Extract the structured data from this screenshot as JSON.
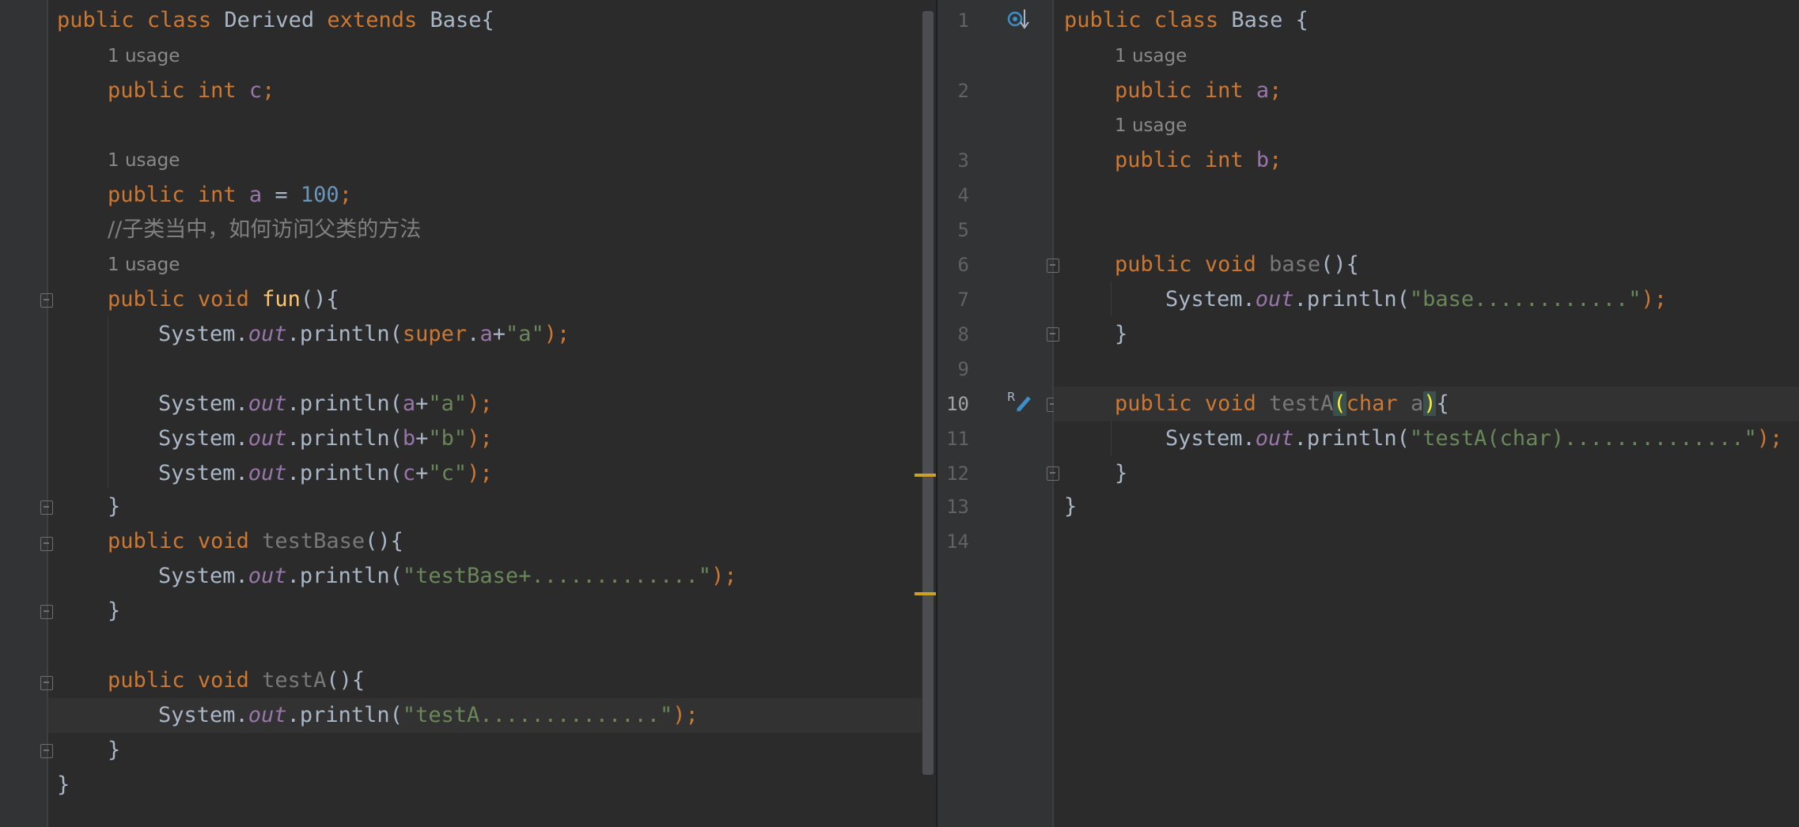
{
  "left_editor": {
    "class_decl": {
      "mod": "public",
      "cls": "class",
      "name": "Derived",
      "ext": "extends",
      "base": "Base",
      "brace": "{"
    },
    "usage_c": "1 usage",
    "field_c": {
      "mod": "public",
      "type": "int",
      "name": "c",
      "semi": ";"
    },
    "usage_a": "1 usage",
    "field_a": {
      "mod": "public",
      "type": "int",
      "name": "a",
      "eq": " = ",
      "value": "100",
      "semi": ";"
    },
    "comment": "//子类当中，如何访问父类的方法",
    "usage_fun": "1 usage",
    "fun_decl": {
      "mod": "public",
      "type": "void",
      "name": "fun",
      "tail": "(){"
    },
    "fun_line1": {
      "sys": "System.",
      "out": "out",
      "call": ".println(",
      "sup": "super",
      "dot": ".",
      "fld": "a",
      "plus": "+",
      "str": "\"a\"",
      "end": ");"
    },
    "fun_line2": {
      "sys": "System.",
      "out": "out",
      "call": ".println(",
      "fld": "a",
      "plus": "+",
      "str": "\"a\"",
      "end": ");"
    },
    "fun_line3": {
      "sys": "System.",
      "out": "out",
      "call": ".println(",
      "fld": "b",
      "plus": "+",
      "str": "\"b\"",
      "end": ");"
    },
    "fun_line4": {
      "sys": "System.",
      "out": "out",
      "call": ".println(",
      "fld": "c",
      "plus": "+",
      "str": "\"c\"",
      "end": ");"
    },
    "close1": "}",
    "testBase_decl": {
      "mod": "public",
      "type": "void",
      "name": "testBase",
      "tail": "(){"
    },
    "testBase_line": {
      "sys": "System.",
      "out": "out",
      "call": ".println(",
      "str": "\"testBase+.............\"",
      "end": ");"
    },
    "close2": "}",
    "testA_decl": {
      "mod": "public",
      "type": "void",
      "name": "testA",
      "tail": "(){"
    },
    "testA_line": {
      "sys": "System.",
      "out": "out",
      "call": ".println(",
      "str": "\"testA..............\"",
      "end": ");"
    },
    "close3": "}",
    "close_class": "}"
  },
  "right_editor": {
    "line_numbers": [
      "1",
      "2",
      "3",
      "4",
      "5",
      "6",
      "7",
      "8",
      "9",
      "10",
      "11",
      "12",
      "13",
      "14"
    ],
    "current_line": "10",
    "class_decl": {
      "mod": "public",
      "cls": "class",
      "name": "Base",
      "brace": " {"
    },
    "usage_a": "1 usage",
    "field_a": {
      "mod": "public",
      "type": "int",
      "name": "a",
      "semi": ";"
    },
    "usage_b": "1 usage",
    "field_b": {
      "mod": "public",
      "type": "int",
      "name": "b",
      "semi": ";"
    },
    "base_decl": {
      "mod": "public",
      "type": "void",
      "name": "base",
      "tail": "(){"
    },
    "base_line": {
      "sys": "System.",
      "out": "out",
      "call": ".println(",
      "str": "\"base............\"",
      "end": ");"
    },
    "close1": "}",
    "testA_decl": {
      "mod": "public",
      "type": "void",
      "name": "testA",
      "open": "(",
      "ptype": "char",
      "pname": "a",
      "close": ")",
      "brace": "{"
    },
    "testA_line": {
      "sys": "System.",
      "out": "out",
      "call": ".println(",
      "str": "\"testA(char)..............\"",
      "end": ");"
    },
    "close2": "}",
    "close_class": "}"
  },
  "colors": {
    "background": "#2b2b2b",
    "gutter": "#313335",
    "keyword": "#cc7832",
    "field": "#9876aa",
    "string": "#6a8759",
    "number": "#6897bb",
    "method": "#ffc66d",
    "text": "#a9b7c6",
    "warning_mark": "#c9a227"
  },
  "icons": [
    "implemented-method-icon",
    "overridden-method-icon",
    "fold-icon"
  ]
}
